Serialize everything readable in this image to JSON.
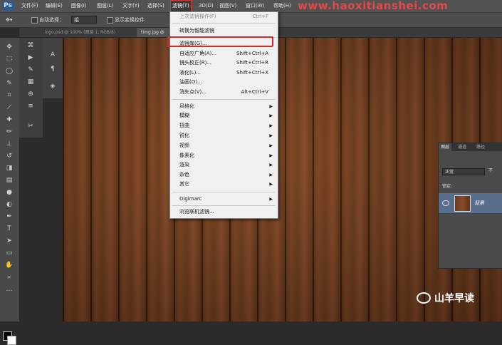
{
  "menubar": {
    "logo": "Ps",
    "items": [
      "文件(F)",
      "编辑(E)",
      "图像(I)",
      "图层(L)",
      "文字(Y)",
      "选择(S)",
      "滤镜(T)",
      "3D(D)",
      "视图(V)",
      "窗口(W)",
      "帮助(H)"
    ],
    "active_index": 6,
    "watermark": "www.haoxitianshei.com"
  },
  "options": {
    "auto_select_label": "自动选择：",
    "auto_select_value": "组",
    "show_transform_label": "显示变换控件"
  },
  "tabs": [
    {
      "label": ".logo.psd @ 100% (图层 1, RGB/8)"
    },
    {
      "label": "timg.jpg @"
    }
  ],
  "filter_menu": {
    "items": [
      {
        "label": "上次滤镜操作(F)",
        "shortcut": "Ctrl+F",
        "disabled": true
      },
      {
        "label": "转换为智能滤镜"
      },
      {
        "label": "滤镜库(G)...",
        "highlighted": true
      },
      {
        "label": "自适应广角(A)...",
        "shortcut": "Shift+Ctrl+A"
      },
      {
        "label": "镜头校正(R)...",
        "shortcut": "Shift+Ctrl+R"
      },
      {
        "label": "液化(L)...",
        "shortcut": "Shift+Ctrl+X"
      },
      {
        "label": "油画(O)..."
      },
      {
        "label": "消失点(V)...",
        "shortcut": "Alt+Ctrl+V"
      },
      {
        "label": "风格化",
        "submenu": true
      },
      {
        "label": "模糊",
        "submenu": true
      },
      {
        "label": "扭曲",
        "submenu": true
      },
      {
        "label": "锐化",
        "submenu": true
      },
      {
        "label": "视频",
        "submenu": true
      },
      {
        "label": "像素化",
        "submenu": true
      },
      {
        "label": "渲染",
        "submenu": true
      },
      {
        "label": "杂色",
        "submenu": true
      },
      {
        "label": "其它",
        "submenu": true
      },
      {
        "label": "Digimarc",
        "submenu": true
      },
      {
        "label": "浏览联机滤镜..."
      }
    ]
  },
  "layers_panel": {
    "tabs": [
      "图层",
      "通道",
      "路径"
    ],
    "blend_mode": "正常",
    "opacity_label": "不",
    "lock_label": "锁定:",
    "layer_name": "背景"
  },
  "branding": {
    "text": "山羊早读"
  },
  "colors": {
    "accent_red": "#d22b2b",
    "menu_bg": "#f0f0f0"
  }
}
